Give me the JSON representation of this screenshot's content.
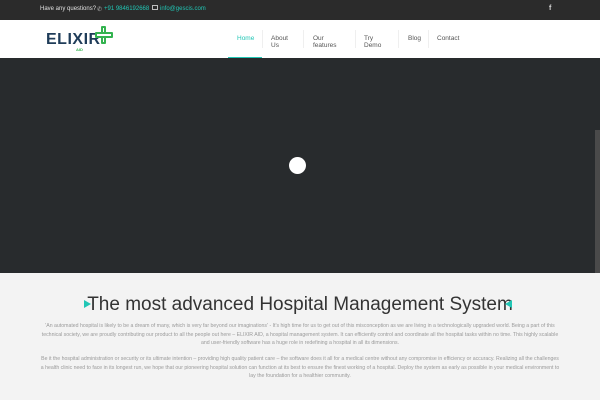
{
  "topbar": {
    "question": "Have any questions?",
    "phone": "+91 9846192668",
    "email": "info@gescis.com",
    "social_icon": "f"
  },
  "logo": {
    "text_main": "ELIXIR",
    "text_sub": "AID"
  },
  "menu": {
    "items": [
      {
        "label": "Home",
        "active": true
      },
      {
        "label": "About Us"
      },
      {
        "label": "Our features"
      },
      {
        "label": "Try Demo"
      },
      {
        "label": "Blog"
      },
      {
        "label": "Contact"
      }
    ]
  },
  "content": {
    "title": "The most advanced Hospital Management System",
    "paragraph1": "'An automated hospital is likely to be a dream of many, which is very far beyond our imaginations' - It's high time for us to get out of this misconception as we are living in a technologically upgraded world. Being a part of this technical society, we are proudly contributing our product to all the people out here – ELIXIR AID, a hospital management system. It can efficiently control and coordinate all the hospital tasks within no time. This highly scalable and user-friendly software has a huge role in redefining a hospital in all its dimensions.",
    "paragraph2": "Be it the hospital administration or security or its ultimate intention – providing high quality patient care – the software does it all for a medical centre without any compromise in efficiency or accuracy. Realizing all the challenges a health clinic need to face in its longest run, we hope that our pioneering hospital solution can function at its best to ensure the finest working of a hospital. Deploy the system as early as possible in your medical environment to lay the foundation for a healthier community."
  },
  "colors": {
    "accent": "#21c6b5",
    "topbar_bg": "#2b2b2b",
    "hero_bg": "#282b2d",
    "logo_green": "#33b34f",
    "logo_navy": "#1f3c59"
  }
}
